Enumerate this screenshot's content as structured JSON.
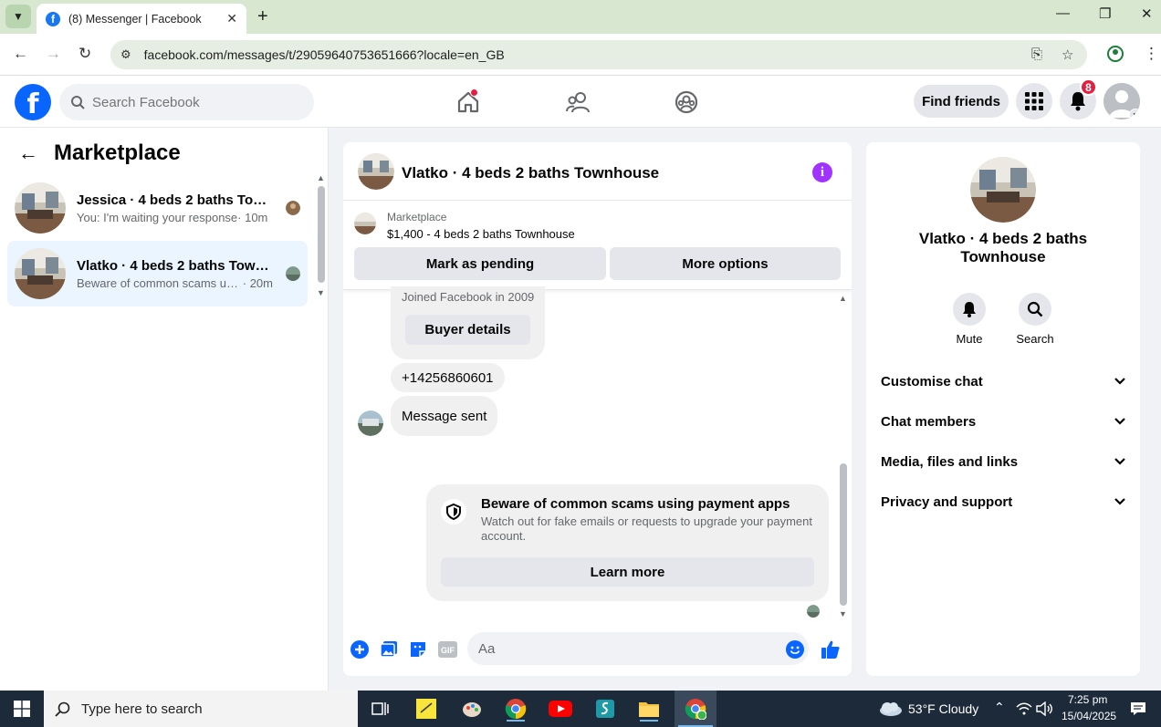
{
  "browser": {
    "tab_title": "(8) Messenger | Facebook",
    "url": "facebook.com/messages/t/29059640753651666?locale=en_GB"
  },
  "fb_header": {
    "search_placeholder": "Search Facebook",
    "find_friends": "Find friends",
    "notification_count": "8"
  },
  "sidebar": {
    "title": "Marketplace",
    "conversations": [
      {
        "name": "Jessica · 4 beds 2 baths Townhouse",
        "snippet": "You: I'm waiting your response",
        "time": " · 10m"
      },
      {
        "name": "Vlatko · 4 beds 2 baths Townhouse",
        "snippet": "Beware of common scams using payment apps",
        "time": " · 20m"
      }
    ]
  },
  "chat": {
    "title": "Vlatko · 4 beds 2 baths Townhouse",
    "marketplace_label": "Marketplace",
    "listing": "$1,400 - 4 beds 2 baths Townhouse",
    "mark_pending": "Mark as pending",
    "more_options": "More options",
    "joined": "Joined Facebook in 2009",
    "buyer_details": "Buyer details",
    "phone_message": "+14256860601",
    "sent_message": "Message sent",
    "scam_title": "Beware of common scams using payment apps",
    "scam_body": "Watch out for fake emails or requests to upgrade your payment account.",
    "learn_more": "Learn more",
    "composer_placeholder": "Aa",
    "gif_label": "GIF"
  },
  "info_panel": {
    "name": "Vlatko · 4 beds 2 baths Townhouse",
    "actions": [
      "Mute",
      "Search"
    ],
    "sections": [
      "Customise chat",
      "Chat members",
      "Media, files and links",
      "Privacy and support"
    ]
  },
  "taskbar": {
    "search_placeholder": "Type here to search",
    "weather": "53°F  Cloudy",
    "time": "7:25 pm",
    "date": "15/04/2025"
  },
  "colors": {
    "facebook_blue": "#0866ff",
    "messenger_purple": "#a033ff",
    "badge_red": "#e41e3f",
    "active_conversation": "#ebf5ff"
  }
}
